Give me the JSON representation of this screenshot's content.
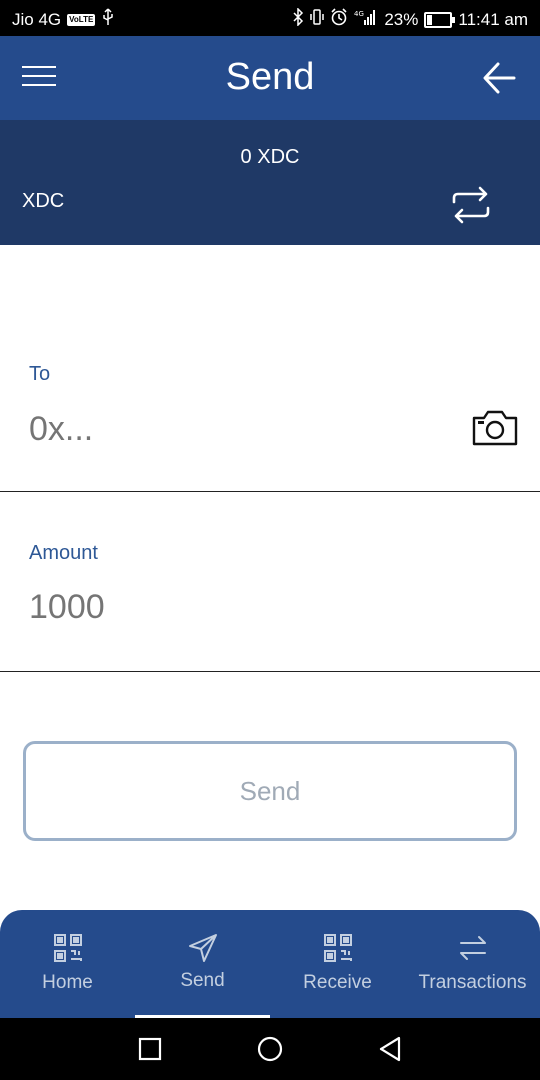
{
  "status_bar": {
    "carrier": "Jio 4G",
    "volte": "VoLTE",
    "usb_icon": "usb-icon",
    "battery_percent": "23%",
    "battery_level": 0.23,
    "time": "11:41 am",
    "icons": [
      "bluetooth-icon",
      "vibrate-icon",
      "alarm-icon",
      "signal-icon",
      "battery-icon"
    ]
  },
  "header": {
    "title": "Send",
    "menu_icon": "hamburger-menu-icon",
    "back_icon": "arrow-left-icon"
  },
  "balance_bar": {
    "balance": "0 XDC",
    "currency": "XDC",
    "swap_icon": "swap-arrows-icon"
  },
  "form": {
    "to_label": "To",
    "to_placeholder": "0x...",
    "camera_icon": "camera-icon",
    "amount_label": "Amount",
    "amount_placeholder": "1000",
    "send_button": "Send"
  },
  "bottom_nav": {
    "active": "Send",
    "items": [
      {
        "label": "Home",
        "icon": "qr-code-icon"
      },
      {
        "label": "Send",
        "icon": "send-paper-plane-icon"
      },
      {
        "label": "Receive",
        "icon": "qr-code-icon"
      },
      {
        "label": "Transactions",
        "icon": "transfer-arrows-icon"
      }
    ]
  },
  "system_nav": [
    "square-recents-icon",
    "circle-home-icon",
    "triangle-back-icon"
  ],
  "colors": {
    "header": "#254b8c",
    "balance_bar": "#1f3966",
    "label": "#2e5896",
    "placeholder": "#9aa0a8"
  }
}
